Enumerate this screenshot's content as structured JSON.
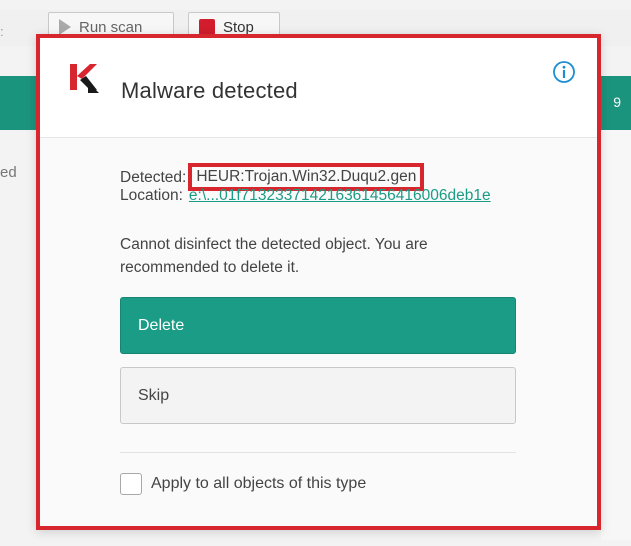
{
  "background": {
    "toolbar_edge_text": ":",
    "run_scan_label": "Run scan",
    "stop_label": "Stop",
    "right_count": "9",
    "left_text": "ed"
  },
  "dialog": {
    "title": "Malware detected",
    "detected_label": "Detected:",
    "threat_name": "HEUR:Trojan.Win32.Duqu2.gen",
    "location_label": "Location:",
    "location_value": "e:\\...01f713233714216361456416006deb1e",
    "message": "Cannot disinfect the detected object. You are recommended to delete it.",
    "delete_label": "Delete",
    "skip_label": "Skip",
    "apply_all_label": "Apply to all objects of this type",
    "apply_all_checked": false
  },
  "colors": {
    "brand_green": "#1b9c86",
    "highlight_red": "#d8262e"
  },
  "icons": {
    "logo": "kaspersky-logo-icon",
    "info": "info-icon",
    "run": "play-icon",
    "stop": "stop-icon"
  }
}
